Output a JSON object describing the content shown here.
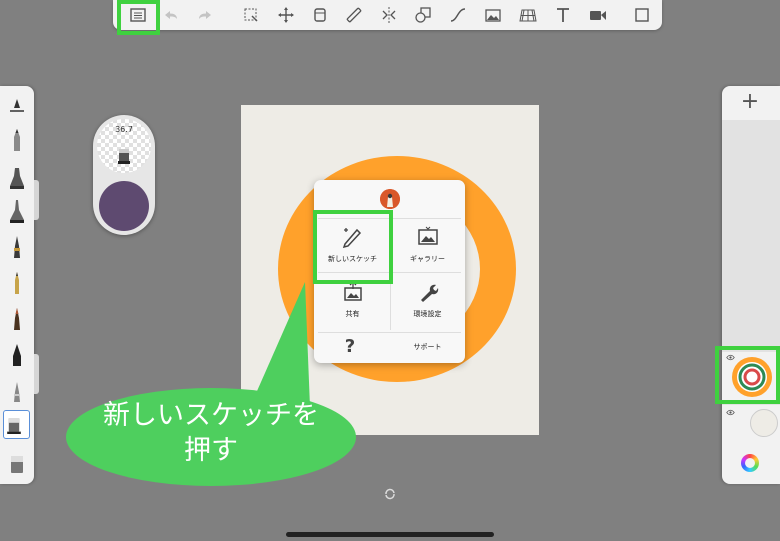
{
  "toolbar": {
    "icons": [
      "gallery-menu-icon",
      "undo-icon",
      "redo-icon",
      "selection-icon",
      "transform-icon",
      "layer-icon",
      "ruler-icon",
      "symmetry-icon",
      "shapes-icon",
      "curve-icon",
      "image-icon",
      "perspective-icon",
      "text-icon",
      "video-icon",
      "fullscreen-icon"
    ]
  },
  "brush_puck": {
    "size_value": "36.7",
    "color": "#5e4a70"
  },
  "menu": {
    "new_sketch_label": "新しいスケッチ",
    "gallery_label": "ギャラリー",
    "share_label": "共有",
    "preferences_label": "環境設定",
    "help_glyph": "?",
    "support_label": "サポート"
  },
  "right_panel": {
    "add_glyph": "+"
  },
  "callout": {
    "line1": "新しいスケッチを",
    "line2": "押す",
    "color": "#4ecf5e"
  },
  "colors": {
    "highlight": "#3fd13f",
    "ring": "#ffa12b",
    "canvas": "#eeece6",
    "background": "#808080"
  }
}
